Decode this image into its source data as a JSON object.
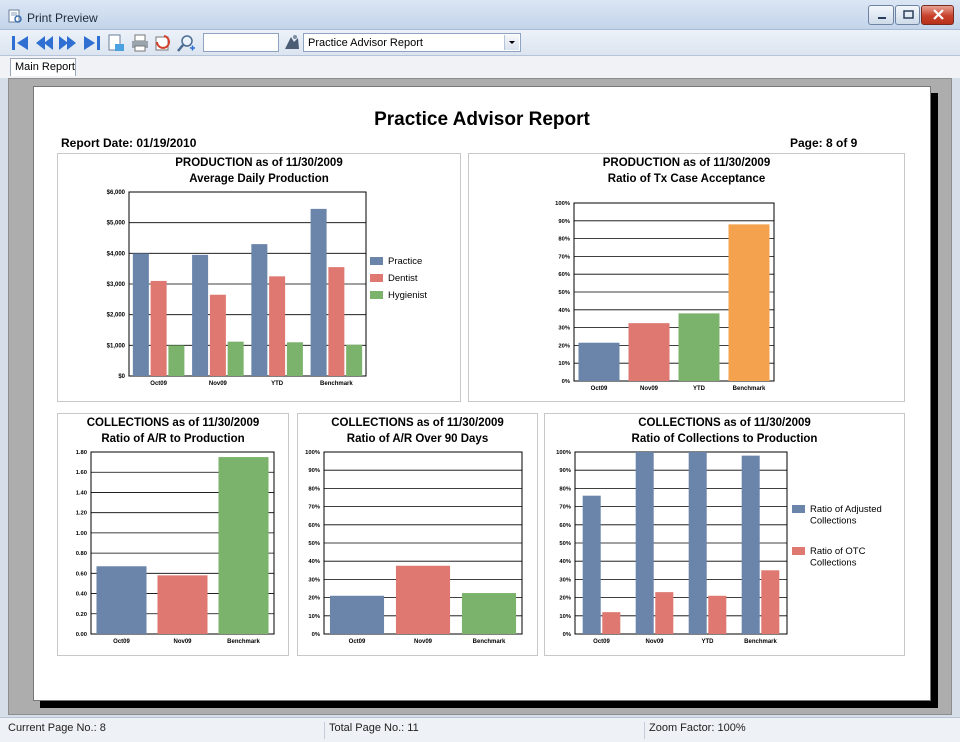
{
  "window": {
    "title": "Print Preview"
  },
  "toolbar": {
    "zoom_value": "",
    "report_select": "Practice Advisor Report",
    "icons": [
      "first-page-icon",
      "previous-page-icon",
      "next-page-icon",
      "last-page-icon",
      "export-icon",
      "print-icon",
      "refresh-icon",
      "zoom-icon",
      "report-icon",
      "dropdown-icon"
    ]
  },
  "tabs": [
    {
      "label": "Main Report"
    }
  ],
  "report": {
    "title": "Practice Advisor Report",
    "report_date_label": "Report Date:  01/19/2010",
    "page_label": "Page: 8 of 9"
  },
  "status": {
    "current_page": "Current Page No.: 8",
    "total_page": "Total Page No.: 11",
    "zoom": "Zoom Factor: 100%"
  },
  "colors": {
    "blue": "#6a84aa",
    "red": "#de7870",
    "green": "#7bb36c",
    "orange": "#f5a24e"
  },
  "chart_data": [
    {
      "type": "bar",
      "title": "PRODUCTION as of 11/30/2009",
      "subtitle": "Average Daily Production",
      "categories": [
        "Oct09",
        "Nov09",
        "YTD",
        "Benchmark"
      ],
      "series": [
        {
          "name": "Practice",
          "values": [
            4000,
            3950,
            4300,
            5450
          ],
          "color": "#6a84aa"
        },
        {
          "name": "Dentist",
          "values": [
            3100,
            2650,
            3250,
            3550
          ],
          "color": "#de7870"
        },
        {
          "name": "Hygienist",
          "values": [
            1000,
            1120,
            1100,
            1020
          ],
          "color": "#7bb36c"
        }
      ],
      "ylim": [
        0,
        6000
      ],
      "yticks": [
        "$0",
        "$1,000",
        "$2,000",
        "$3,000",
        "$4,000",
        "$5,000",
        "$6,000"
      ],
      "legend": "right"
    },
    {
      "type": "bar",
      "title": "PRODUCTION as of 11/30/2009",
      "subtitle": "Ratio of Tx Case Acceptance",
      "categories": [
        "Oct09",
        "Nov09",
        "YTD",
        "Benchmark"
      ],
      "values": [
        21.5,
        32.5,
        38,
        88
      ],
      "colors": [
        "#6a84aa",
        "#de7870",
        "#7bb36c",
        "#f5a24e"
      ],
      "ylim": [
        0,
        100
      ],
      "yticks": [
        "0%",
        "10%",
        "20%",
        "30%",
        "40%",
        "50%",
        "60%",
        "70%",
        "80%",
        "90%",
        "100%"
      ]
    },
    {
      "type": "bar",
      "title": "COLLECTIONS as of 11/30/2009",
      "subtitle": "Ratio of A/R to Production",
      "categories": [
        "Oct09",
        "Nov09",
        "Benchmark"
      ],
      "values": [
        0.67,
        0.58,
        1.75
      ],
      "colors": [
        "#6a84aa",
        "#de7870",
        "#7bb36c"
      ],
      "ylim": [
        0,
        1.8
      ],
      "yticks": [
        "0.00",
        "0.20",
        "0.40",
        "0.60",
        "0.80",
        "1.00",
        "1.20",
        "1.40",
        "1.60",
        "1.80"
      ]
    },
    {
      "type": "bar",
      "title": "COLLECTIONS as of 11/30/2009",
      "subtitle": "Ratio of A/R Over 90 Days",
      "categories": [
        "Oct09",
        "Nov09",
        "Benchmark"
      ],
      "values": [
        21,
        37.5,
        22.5
      ],
      "colors": [
        "#6a84aa",
        "#de7870",
        "#7bb36c"
      ],
      "ylim": [
        0,
        100
      ],
      "yticks": [
        "0%",
        "10%",
        "20%",
        "30%",
        "40%",
        "50%",
        "60%",
        "70%",
        "80%",
        "90%",
        "100%"
      ]
    },
    {
      "type": "bar",
      "title": "COLLECTIONS as of 11/30/2009",
      "subtitle": "Ratio of Collections to Production",
      "categories": [
        "Oct09",
        "Nov09",
        "YTD",
        "Benchmark"
      ],
      "series": [
        {
          "name": "Ratio of Adjusted Collections",
          "values": [
            76,
            100,
            100,
            98
          ],
          "color": "#6a84aa"
        },
        {
          "name": "Ratio of OTC Collections",
          "values": [
            12,
            23,
            21,
            35
          ],
          "color": "#de7870"
        }
      ],
      "ylim": [
        0,
        100
      ],
      "yticks": [
        "0%",
        "10%",
        "20%",
        "30%",
        "40%",
        "50%",
        "60%",
        "70%",
        "80%",
        "90%",
        "100%"
      ],
      "legend": "right"
    }
  ]
}
